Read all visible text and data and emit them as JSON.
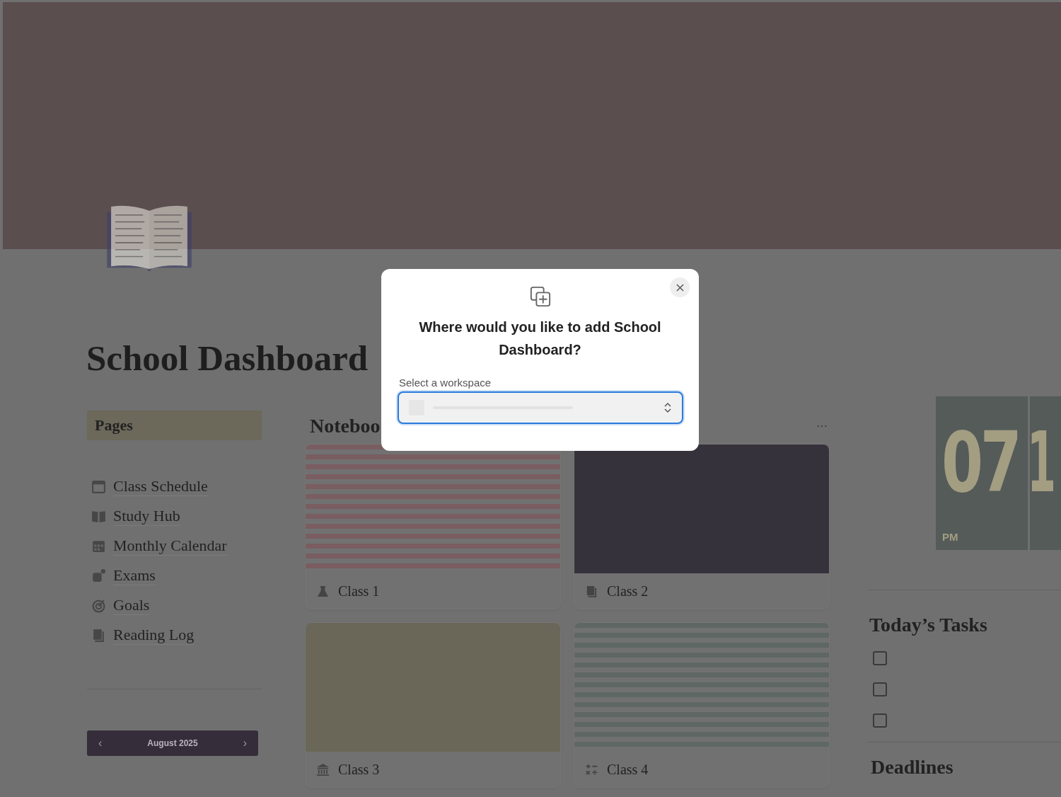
{
  "title": "School Dashboard",
  "pages": {
    "heading": "Pages",
    "items": [
      {
        "label": "Class Schedule"
      },
      {
        "label": "Study Hub"
      },
      {
        "label": "Monthly Calendar"
      },
      {
        "label": "Exams"
      },
      {
        "label": "Goals"
      },
      {
        "label": "Reading Log"
      }
    ]
  },
  "calendar": {
    "prev": "‹",
    "month": "August 2025",
    "next": "›"
  },
  "gallery": {
    "title": "Noteboo",
    "more": "···",
    "cards": [
      {
        "title": "Class 1",
        "kind": "striped",
        "color": "#7a5d61"
      },
      {
        "title": "Class 2",
        "kind": "solid",
        "color": "#36323b"
      },
      {
        "title": "Class 3",
        "kind": "solid",
        "color": "#6b6758"
      },
      {
        "title": "Class 4",
        "kind": "striped",
        "color": "#5e6763"
      }
    ]
  },
  "clock": {
    "hour": "07",
    "minute": "1",
    "period": "PM"
  },
  "tasks": {
    "heading": "Today’s Tasks",
    "items": [
      {
        "checked": false
      },
      {
        "checked": false
      },
      {
        "checked": false
      }
    ]
  },
  "deadlines": {
    "heading": "Deadlines"
  },
  "modal": {
    "title": "Where would you like to add School Dashboard?",
    "field_label": "Select a workspace"
  }
}
